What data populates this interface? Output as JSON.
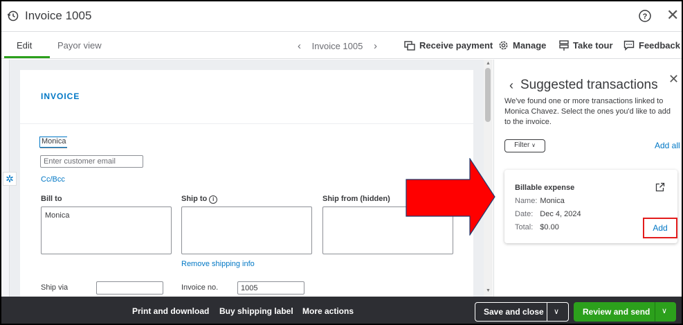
{
  "header": {
    "title": "Invoice 1005"
  },
  "tabs": {
    "edit": "Edit",
    "payor": "Payor view"
  },
  "nav": {
    "prev": "‹",
    "label": "Invoice 1005",
    "next": "›"
  },
  "toolbar": {
    "receive_payment": "Receive payment",
    "manage": "Manage",
    "take_tour": "Take tour",
    "feedback": "Feedback"
  },
  "invoice": {
    "heading": "INVOICE",
    "customer_value": "Monica",
    "email_placeholder": "Enter customer email",
    "cc_bcc": "Cc/Bcc",
    "bill_to_label": "Bill to",
    "bill_to_value": "Monica",
    "ship_to_label": "Ship to",
    "ship_from_label": "Ship from (hidden)",
    "remove_shipping": "Remove shipping info",
    "ship_via_label": "Ship via",
    "invoice_no_label": "Invoice no.",
    "invoice_no_value": "1005"
  },
  "panel": {
    "title": "Suggested transactions",
    "description": "We've found one or more transactions linked to Monica Chavez. Select the ones you'd like to add to the invoice.",
    "filter": "Filter",
    "add_all": "Add all",
    "card": {
      "title": "Billable expense",
      "name_label": "Name:",
      "name_value": "Monica",
      "date_label": "Date:",
      "date_value": "Dec 4, 2024",
      "total_label": "Total:",
      "total_value": "$0.00",
      "add": "Add"
    }
  },
  "footer": {
    "print": "Print and download",
    "shipping": "Buy shipping label",
    "more": "More actions",
    "save_close": "Save and close",
    "review_send": "Review and send"
  },
  "colors": {
    "accent_green": "#2ca01c",
    "link_blue": "#0077c5",
    "annotation_red": "#ff0000",
    "footer_dark": "#2d2e33"
  }
}
